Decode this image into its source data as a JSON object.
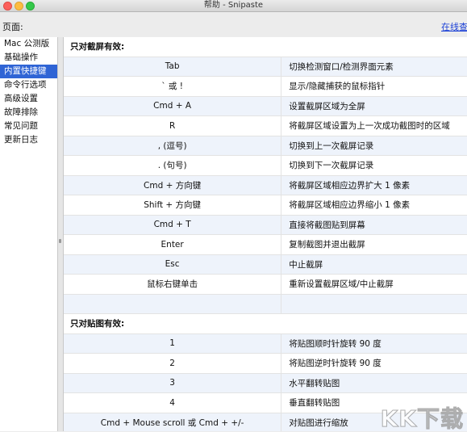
{
  "window": {
    "title": "帮助 - Snipaste"
  },
  "topbar": {
    "page_label": "页面:",
    "online_link": "在线查"
  },
  "sidebar": {
    "items": [
      {
        "label": "Mac 公测版"
      },
      {
        "label": "基础操作"
      },
      {
        "label": "内置快捷键"
      },
      {
        "label": "命令行选项"
      },
      {
        "label": "高级设置"
      },
      {
        "label": "故障排除"
      },
      {
        "label": "常见问题"
      },
      {
        "label": "更新日志"
      }
    ],
    "active_index": 2
  },
  "sections": {
    "screenshot_header": "只对截屏有效:",
    "screenshot_rows": [
      {
        "key": "Tab",
        "desc": "切换检测窗口/检测界面元素"
      },
      {
        "key": "` 或 !",
        "desc": "显示/隐藏捕获的鼠标指针"
      },
      {
        "key": "Cmd + A",
        "desc": "设置截屏区域为全屏"
      },
      {
        "key": "R",
        "desc": "将截屏区域设置为上一次成功截图时的区域"
      },
      {
        "key": ", (逗号)",
        "desc": "切换到上一次截屏记录"
      },
      {
        "key": ". (句号)",
        "desc": "切换到下一次截屏记录"
      },
      {
        "key": "Cmd + 方向键",
        "desc": "将截屏区域相应边界扩大 1 像素"
      },
      {
        "key": "Shift + 方向键",
        "desc": "将截屏区域相应边界缩小 1 像素"
      },
      {
        "key": "Cmd + T",
        "desc": "直接将截图贴到屏幕"
      },
      {
        "key": "Enter",
        "desc": "复制截图并退出截屏"
      },
      {
        "key": "Esc",
        "desc": "中止截屏"
      },
      {
        "key": "鼠标右键单击",
        "desc": "重新设置截屏区域/中止截屏"
      }
    ],
    "paste_header": "只对贴图有效:",
    "paste_rows": [
      {
        "key": "1",
        "desc": "将贴图顺时针旋转 90 度"
      },
      {
        "key": "2",
        "desc": "将贴图逆时针旋转 90 度"
      },
      {
        "key": "3",
        "desc": "水平翻转贴图"
      },
      {
        "key": "4",
        "desc": "垂直翻转贴图"
      },
      {
        "key": "Cmd + Mouse scroll 或 Cmd + +/-",
        "desc": "对贴图进行缩放"
      }
    ]
  },
  "watermark": {
    "text": "KK下载"
  },
  "colors": {
    "active_item": "#2f64d5",
    "link": "#1a3fd6",
    "alt_row": "#eef3fb"
  }
}
